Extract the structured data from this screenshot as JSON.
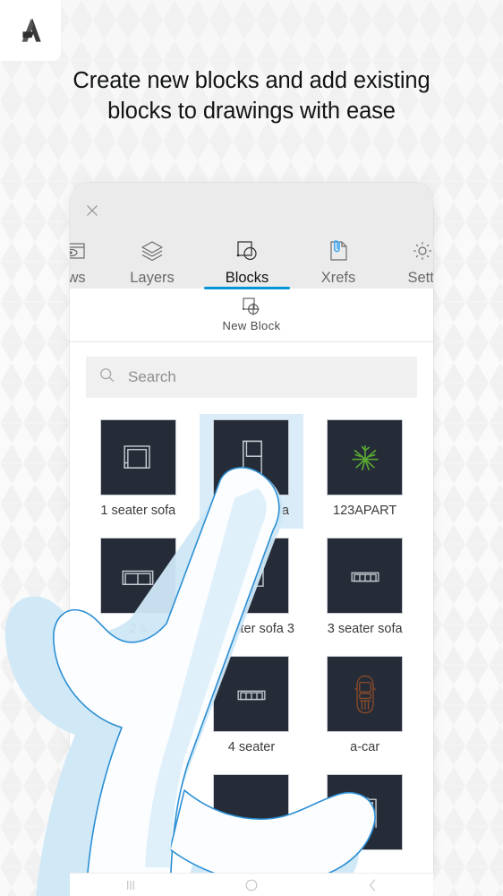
{
  "brand": {
    "logo_icon": "autodesk-a-logo"
  },
  "headline": {
    "line1": "Create new blocks and add existing",
    "line2": "blocks to drawings with ease"
  },
  "panel": {
    "close_icon": "close-icon",
    "tabs": [
      {
        "label": "ews",
        "full_label": "Views",
        "icon": "views-eye-icon",
        "active": false
      },
      {
        "label": "Layers",
        "full_label": "Layers",
        "icon": "layers-stack-icon",
        "active": false
      },
      {
        "label": "Blocks",
        "full_label": "Blocks",
        "icon": "blocks-icon",
        "active": true
      },
      {
        "label": "Xrefs",
        "full_label": "Xrefs",
        "icon": "xrefs-paperclip-icon",
        "active": false
      },
      {
        "label": "Setti",
        "full_label": "Settings",
        "icon": "settings-gear-icon",
        "active": false
      }
    ],
    "subbar": {
      "label": "New Block",
      "icon": "new-block-icon"
    },
    "search": {
      "placeholder": "Search",
      "value": "",
      "icon": "search-icon"
    },
    "blocks": [
      {
        "label": "1 seater sofa",
        "icon": "sofa-1-seater-plan",
        "selected": false
      },
      {
        "label": "2 seater sofa",
        "icon": "sofa-2-seater-plan",
        "selected": true
      },
      {
        "label": "123APART",
        "icon": "plant-green-icon",
        "selected": false
      },
      {
        "label": "2 s",
        "icon": "sofa-bench-plan",
        "selected": false
      },
      {
        "label": "1 seater sofa 3",
        "icon": "sofa-1-seater-3-plan",
        "selected": false
      },
      {
        "label": "3 seater sofa",
        "icon": "sofa-3-seater-plan",
        "selected": false
      },
      {
        "label": "",
        "icon": "",
        "selected": false
      },
      {
        "label": "4 seater",
        "icon": "sofa-4-seater-plan",
        "selected": false
      },
      {
        "label": "a-car",
        "icon": "car-top-view-icon",
        "selected": false
      },
      {
        "label": "",
        "icon": "",
        "selected": false
      },
      {
        "label": "",
        "icon": "",
        "selected": false
      },
      {
        "label": "",
        "icon": "door-plan-icon",
        "selected": false
      }
    ]
  },
  "navbar": {
    "recents_icon": "recent-apps-icon",
    "home_icon": "home-circle-icon",
    "back_icon": "back-chevron-icon"
  },
  "colors": {
    "accent_blue": "#0696d7",
    "selection_blue": "#d9ecf8",
    "thumb_bg": "#252c38",
    "tabbar_bg": "#ebebeb",
    "page_bg": "#f1f1f1",
    "plant_green": "#5aa832",
    "car_orange": "#8a4a2a"
  },
  "overlay": {
    "hand_icon": "pointing-hand-illustration"
  }
}
